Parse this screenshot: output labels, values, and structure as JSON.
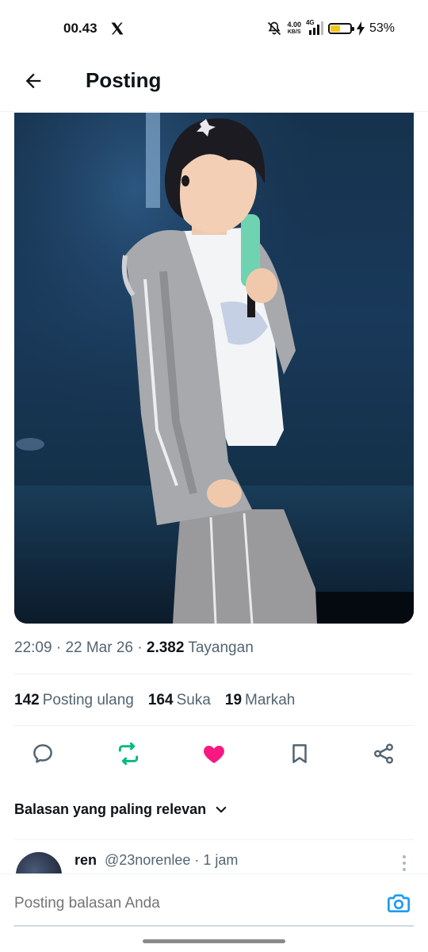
{
  "status_bar": {
    "time": "00.43",
    "net_speed_value": "4.00",
    "net_speed_unit": "KB/S",
    "network": "4G",
    "battery_percent": "53%",
    "battery_level": 0.53,
    "icons": [
      "x-logo-icon",
      "mute-bell-icon",
      "signal-icon",
      "battery-icon",
      "charging-bolt-icon"
    ]
  },
  "header": {
    "title": "Posting",
    "back_icon": "back-arrow-icon"
  },
  "post": {
    "image_alt": "Photo of a performer on stage wearing a grey zip hoodie and track pants, holding a mint-green microphone",
    "time": "22:09",
    "date": "22 Mar 26",
    "views_count": "2.382",
    "views_label": "Tayangan",
    "stats": {
      "reposts_count": "142",
      "reposts_label": "Posting ulang",
      "likes_count": "164",
      "likes_label": "Suka",
      "bookmarks_count": "19",
      "bookmarks_label": "Markah"
    },
    "actions": {
      "reply_icon": "reply-icon",
      "repost_icon": "repost-icon",
      "repost_color": "#00ba7c",
      "like_icon": "heart-icon",
      "like_color": "#f91880",
      "bookmark_icon": "bookmark-icon",
      "share_icon": "share-icon"
    }
  },
  "replies": {
    "sort_label": "Balasan yang paling relevan",
    "items": [
      {
        "name": "ren",
        "handle": "@23norenlee",
        "time": "· 1 jam"
      }
    ]
  },
  "composer": {
    "placeholder": "Posting balasan Anda",
    "camera_icon": "camera-icon",
    "accent_color": "#1d9bf0"
  }
}
